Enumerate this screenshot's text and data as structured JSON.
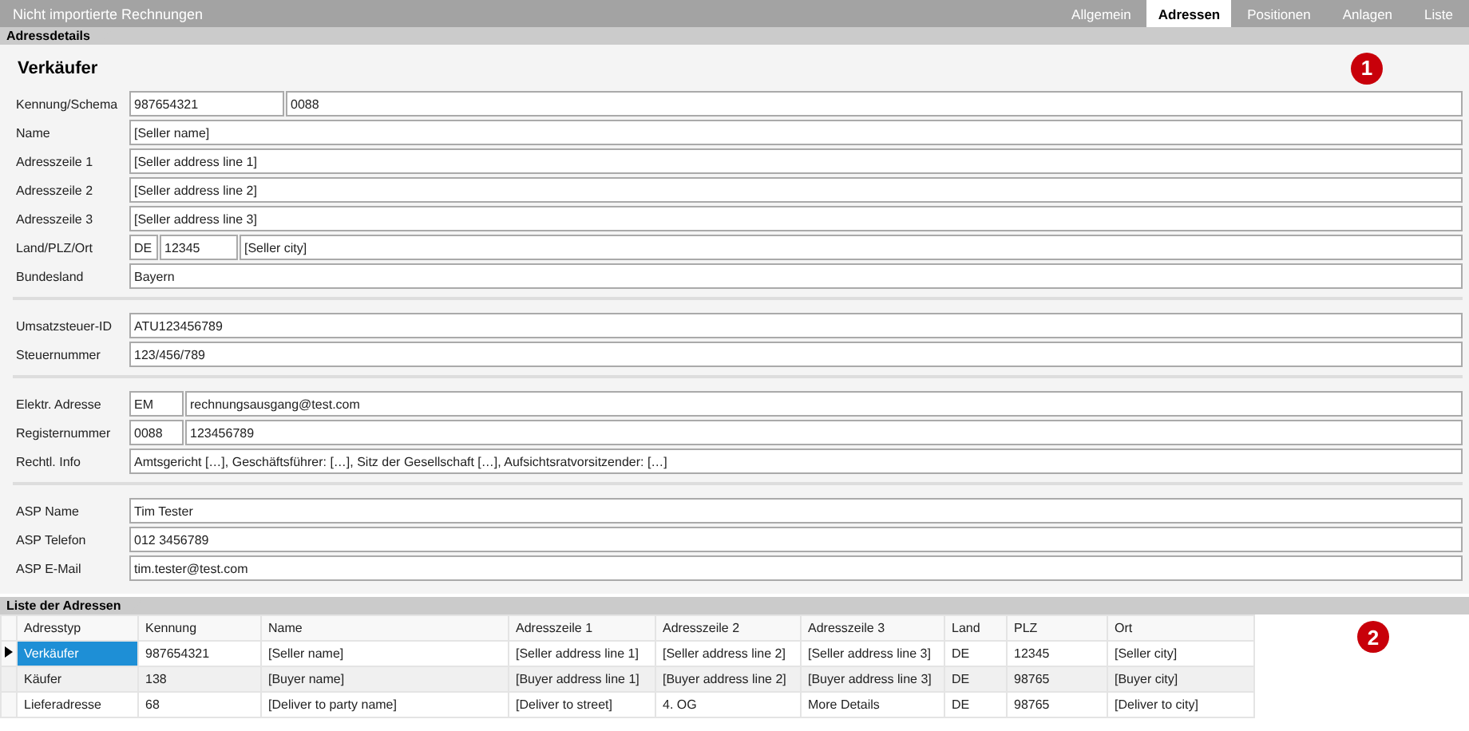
{
  "window": {
    "title": "Nicht importierte Rechnungen"
  },
  "tabs": [
    {
      "label": "Allgemein",
      "selected": false
    },
    {
      "label": "Adressen",
      "selected": true
    },
    {
      "label": "Positionen",
      "selected": false
    },
    {
      "label": "Anlagen",
      "selected": false
    },
    {
      "label": "Liste",
      "selected": false
    }
  ],
  "details": {
    "title": "Adressdetails",
    "heading": "Verkäufer",
    "callout": "1",
    "groups": [
      {
        "rows": [
          {
            "label": "Kennung/Schema",
            "fields": [
              {
                "kind": "id",
                "value": "987654321"
              },
              {
                "kind": "wide",
                "value": "0088"
              }
            ]
          },
          {
            "label": "Name",
            "fields": [
              {
                "kind": "wide",
                "value": "[Seller name]"
              }
            ]
          },
          {
            "label": "Adresszeile 1",
            "fields": [
              {
                "kind": "wide",
                "value": "[Seller address line 1]"
              }
            ]
          },
          {
            "label": "Adresszeile 2",
            "fields": [
              {
                "kind": "wide",
                "value": "[Seller address line 2]"
              }
            ]
          },
          {
            "label": "Adresszeile 3",
            "fields": [
              {
                "kind": "wide",
                "value": "[Seller address line 3]"
              }
            ]
          },
          {
            "label": "Land/PLZ/Ort",
            "fields": [
              {
                "kind": "code",
                "value": "DE"
              },
              {
                "kind": "medium",
                "value": "12345"
              },
              {
                "kind": "wide",
                "value": "[Seller city]"
              }
            ]
          },
          {
            "label": "Bundesland",
            "fields": [
              {
                "kind": "wide",
                "value": "Bayern"
              }
            ]
          }
        ]
      },
      {
        "rows": [
          {
            "label": "Umsatzsteuer-ID",
            "fields": [
              {
                "kind": "wide",
                "value": "ATU123456789"
              }
            ]
          },
          {
            "label": "Steuernummer",
            "fields": [
              {
                "kind": "wide",
                "value": "123/456/789"
              }
            ]
          }
        ]
      },
      {
        "rows": [
          {
            "label": "Elektr. Adresse",
            "fields": [
              {
                "kind": "short",
                "value": "EM"
              },
              {
                "kind": "wide",
                "value": "rechnungsausgang@test.com"
              }
            ]
          },
          {
            "label": "Registernummer",
            "fields": [
              {
                "kind": "short",
                "value": "0088"
              },
              {
                "kind": "wide",
                "value": "123456789"
              }
            ]
          },
          {
            "label": "Rechtl. Info",
            "fields": [
              {
                "kind": "wide",
                "value": "Amtsgericht […], Geschäftsführer: […], Sitz der Gesellschaft […], Aufsichtsratvorsitzender: […]"
              }
            ]
          }
        ]
      },
      {
        "rows": [
          {
            "label": "ASP Name",
            "fields": [
              {
                "kind": "wide",
                "value": "Tim Tester"
              }
            ]
          },
          {
            "label": "ASP Telefon",
            "fields": [
              {
                "kind": "wide",
                "value": "012 3456789"
              }
            ]
          },
          {
            "label": "ASP E-Mail",
            "fields": [
              {
                "kind": "wide",
                "value": "tim.tester@test.com"
              }
            ]
          }
        ]
      }
    ]
  },
  "list": {
    "title": "Liste der Adressen",
    "callout": "2",
    "columns": [
      "Adresstyp",
      "Kennung",
      "Name",
      "Adresszeile 1",
      "Adresszeile 2",
      "Adresszeile 3",
      "Land",
      "PLZ",
      "Ort"
    ],
    "rows": [
      {
        "selected": true,
        "cells": [
          "Verkäufer",
          "987654321",
          "[Seller name]",
          "[Seller address line 1]",
          "[Seller address line 2]",
          "[Seller address line 3]",
          "DE",
          "12345",
          "[Seller city]"
        ]
      },
      {
        "selected": false,
        "cells": [
          "Käufer",
          "138",
          "[Buyer name]",
          "[Buyer address line 1]",
          "[Buyer address line 2]",
          "[Buyer address line 3]",
          "DE",
          "98765",
          "[Buyer city]"
        ]
      },
      {
        "selected": false,
        "cells": [
          "Lieferadresse",
          "68",
          "[Deliver to party name]",
          "[Deliver to street]",
          "4. OG",
          "More Details",
          "DE",
          "98765",
          "[Deliver to city]"
        ]
      }
    ]
  }
}
